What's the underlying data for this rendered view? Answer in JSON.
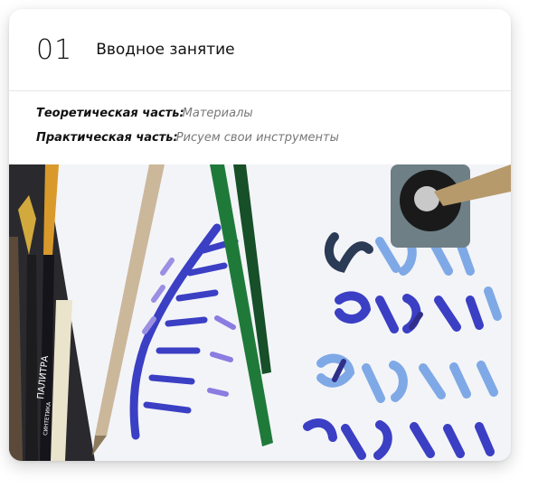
{
  "lesson": {
    "number": "01",
    "title": "Вводное занятие"
  },
  "details": [
    {
      "label": "Теоретическая часть:",
      "value": "Материалы"
    },
    {
      "label": "Практическая часть:",
      "value": "Рисуем свои инструменты"
    }
  ],
  "photo": {
    "subject": "calligraphy-tools-and-blackletter-photo",
    "pencil_text": "ПАЛИТРА",
    "pencil_subtext": "СИНТЕТИКА",
    "colors": {
      "ink_blue": "#3b3fc4",
      "ink_light_blue": "#7fa9e6",
      "ink_violet": "#7b5cc9",
      "green_brush": "#1f7a3a",
      "wood_pencil": "#cbb79a"
    }
  }
}
